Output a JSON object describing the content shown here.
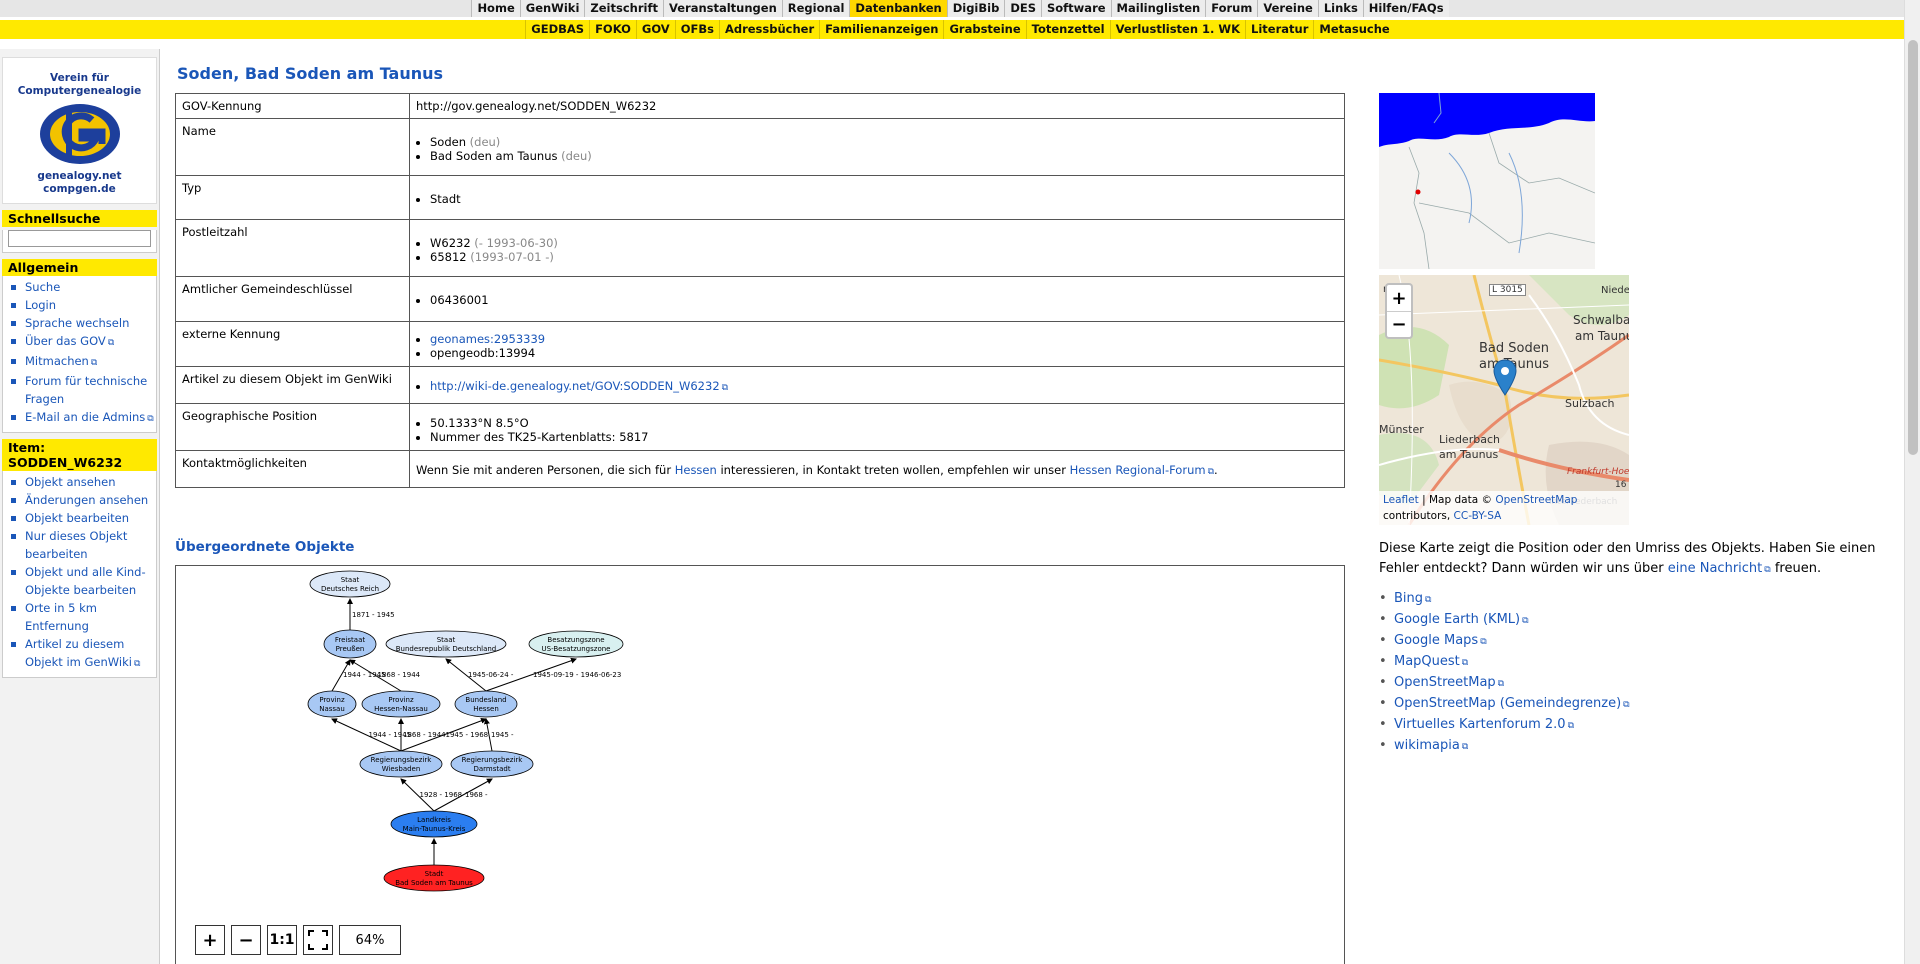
{
  "topnav1": [
    "Home",
    "GenWiki",
    "Zeitschrift",
    "Veranstaltungen",
    "Regional",
    "Datenbanken",
    "DigiBib",
    "DES",
    "Software",
    "Mailinglisten",
    "Forum",
    "Vereine",
    "Links",
    "Hilfen/FAQs"
  ],
  "topnav1_active": "Datenbanken",
  "topnav2": [
    "GEDBAS",
    "FOKO",
    "GOV",
    "OFBs",
    "Adressbücher",
    "Familienanzeigen",
    "Grabsteine",
    "Totenzettel",
    "Verlustlisten 1. WK",
    "Literatur",
    "Metasuche"
  ],
  "logo": {
    "org_line1": "Verein für",
    "org_line2": "Computergenealogie",
    "site1": "genealogy.net",
    "site2": "compgen.de"
  },
  "sidebar": {
    "search_title": "Schnellsuche",
    "general_title": "Allgemein",
    "general_items": [
      "Suche",
      "Login",
      "Sprache wechseln",
      "Über das GOV",
      "Mitmachen",
      "Forum für technische Fragen",
      "E-Mail an die Admins"
    ],
    "item_title": "Item: SODDEN_W6232",
    "item_items": [
      "Objekt ansehen",
      "Änderungen ansehen",
      "Objekt bearbeiten",
      "Nur dieses Objekt bearbeiten",
      "Objekt und alle Kind-Objekte bearbeiten",
      "Orte in 5 km Entfernung",
      "Artikel zu diesem Objekt im GenWiki"
    ]
  },
  "page_title": "Soden, Bad Soden am Taunus",
  "table": {
    "gov_label": "GOV-Kennung",
    "gov_value": "http://gov.genealogy.net/SODDEN_W6232",
    "name_label": "Name",
    "name1": "Soden",
    "name1_lang": "(deu)",
    "name2": "Bad Soden am Taunus",
    "name2_lang": "(deu)",
    "typ_label": "Typ",
    "typ_value": "Stadt",
    "plz_label": "Postleitzahl",
    "plz1": "W6232",
    "plz1_note": "(- 1993-06-30)",
    "plz2": "65812",
    "plz2_note": "(1993-07-01 -)",
    "ags_label": "Amtlicher Gemeindeschlüssel",
    "ags_value": "06436001",
    "ext_label": "externe Kennung",
    "ext1": "geonames:2953339",
    "ext2": "opengeodb:13994",
    "wiki_label": "Artikel zu diesem Objekt im GenWiki",
    "wiki_value": "http://wiki-de.genealogy.net/GOV:SODDEN_W6232",
    "geo_label": "Geographische Position",
    "geo1": "50.1333°N 8.5°O",
    "geo2": "Nummer des TK25-Kartenblatts: 5817",
    "contact_label": "Kontaktmöglichkeiten",
    "contact_pre": "Wenn Sie mit anderen Personen, die sich für",
    "contact_link1": "Hessen",
    "contact_mid": "interessieren, in Kontakt treten wollen, empfehlen wir unser",
    "contact_link2": "Hessen Regional-Forum",
    "contact_post": "."
  },
  "superior_title": "Übergeordnete Objekte",
  "graph": {
    "nodes": [
      {
        "id": "reich",
        "l1": "Staat",
        "l2": "Deutsches Reich"
      },
      {
        "id": "preussen",
        "l1": "Freistaat",
        "l2": "Preußen"
      },
      {
        "id": "brd",
        "l1": "Staat",
        "l2": "Bundesrepublik Deutschland"
      },
      {
        "id": "us",
        "l1": "Besatzungszone",
        "l2": "US-Besatzungszone"
      },
      {
        "id": "nassau",
        "l1": "Provinz",
        "l2": "Nassau"
      },
      {
        "id": "hn",
        "l1": "Provinz",
        "l2": "Hessen-Nassau"
      },
      {
        "id": "hessen",
        "l1": "Bundesland",
        "l2": "Hessen"
      },
      {
        "id": "wi",
        "l1": "Regierungsbezirk",
        "l2": "Wiesbaden"
      },
      {
        "id": "da",
        "l1": "Regierungsbezirk",
        "l2": "Darmstadt"
      },
      {
        "id": "mtk",
        "l1": "Landkreis",
        "l2": "Main-Taunus-Kreis"
      },
      {
        "id": "soden",
        "l1": "Stadt",
        "l2": "Bad Soden am Taunus"
      }
    ],
    "edges": [
      "1871 - 1945",
      "1944 - 1945",
      "1868 - 1944",
      "1945-06-24 -",
      "1945-09-19 - 1946-06-23",
      "1944 - 1945",
      "1868 - 1944",
      "1945 - 1968",
      "1945 -",
      "1928 - 1968",
      "1968 -"
    ],
    "zoom": "64%",
    "btn_plus": "+",
    "btn_minus": "−",
    "btn_one": "1:1"
  },
  "map": {
    "labels": [
      "nhain",
      "L 3015",
      "Niede",
      "Schwalba",
      "am Taunu",
      "Bad Soden",
      "am Taunus",
      "Sulzbach",
      "Münster",
      "Liederbach",
      "am Taunus",
      "Frankfurt-Hoe",
      "16",
      "interliederbach"
    ],
    "zoom_in": "+",
    "zoom_out": "−",
    "attr_leaflet": "Leaflet",
    "attr_mid": "| Map data ©",
    "attr_osm": "OpenStreetMap",
    "attr_contrib": "contributors,",
    "attr_cc": "CC-BY-SA",
    "colors": {
      "water": "#0000ff",
      "marker": "#2a81cb",
      "road": "#f3c660",
      "landuse": "#d9e6c8"
    }
  },
  "map_desc_pre": "Diese Karte zeigt die Position oder den Umriss des Objekts. Haben Sie einen Fehler entdeckt? Dann würden wir uns über",
  "map_desc_link": "eine Nachricht",
  "map_desc_post": "freuen.",
  "links": [
    "Bing",
    "Google Earth (KML)",
    "Google Maps",
    "MapQuest",
    "OpenStreetMap",
    "OpenStreetMap (Gemeindegrenze)",
    "Virtuelles Kartenforum 2.0",
    "wikimapia"
  ]
}
